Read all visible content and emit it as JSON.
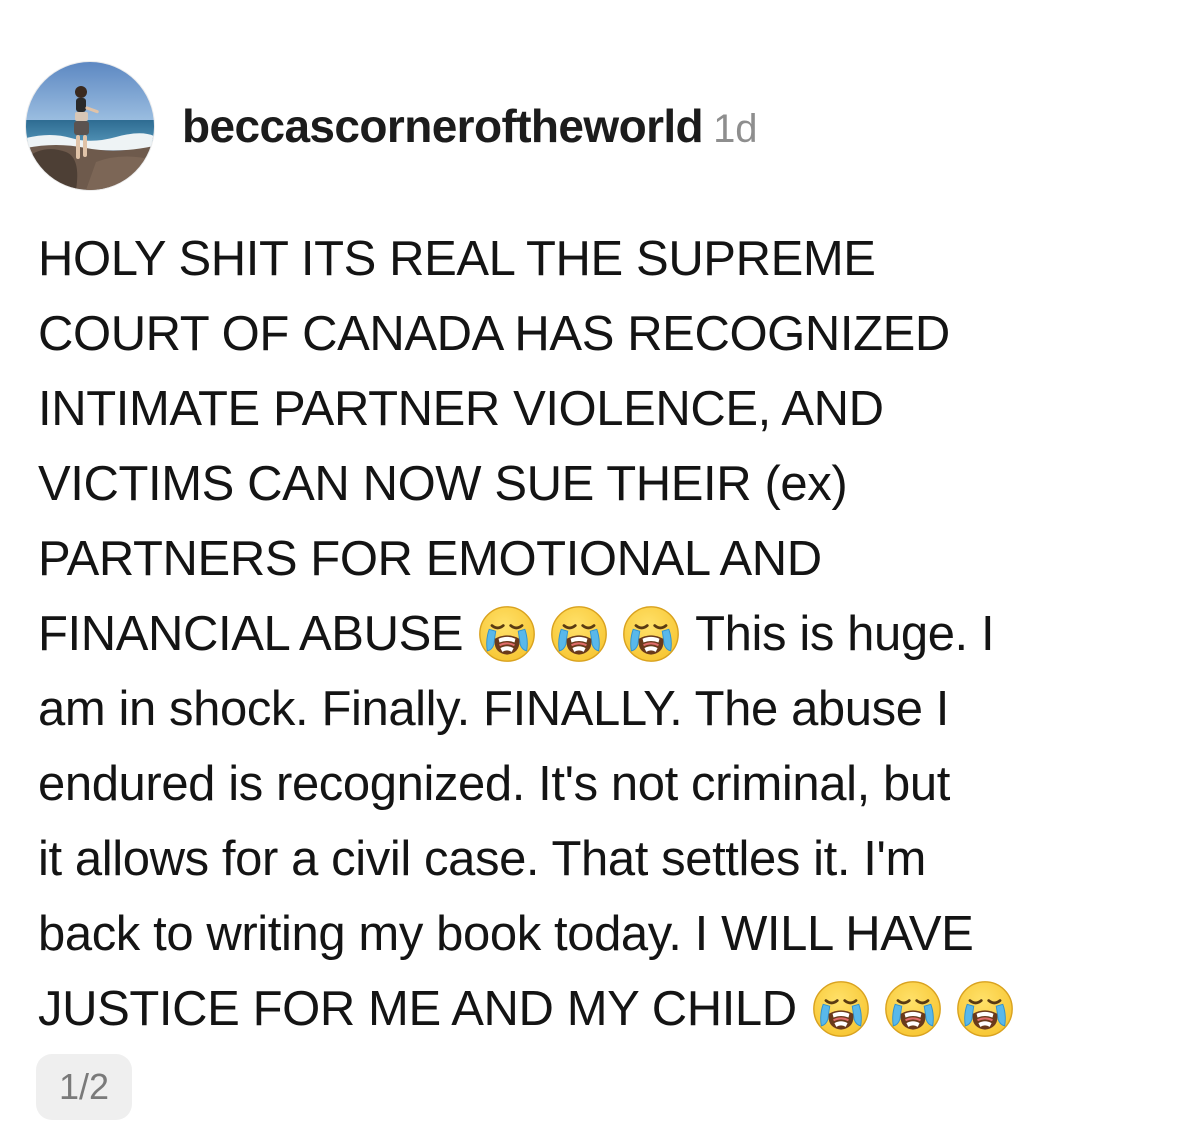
{
  "post": {
    "avatar": "profile-photo",
    "username": "beccascorneroftheworld",
    "time": "1d"
  },
  "caption": {
    "lines": [
      {
        "text": "HOLY SHIT ITS REAL THE SUPREME"
      },
      {
        "text": "COURT OF CANADA HAS RECOGNIZED"
      },
      {
        "text": "INTIMATE PARTNER VIOLENCE, AND"
      },
      {
        "text": "VICTIMS CAN NOW SUE THEIR (ex)"
      },
      {
        "text": "PARTNERS FOR EMOTIONAL AND"
      },
      {
        "before": "FINANCIAL ABUSE",
        "emoji": [
          "😭",
          "😭",
          "😭"
        ],
        "after": "This is huge. I"
      },
      {
        "text": "am in shock. Finally. FINALLY. The abuse I"
      },
      {
        "text": "endured is recognized. It's not criminal, but"
      },
      {
        "text": "it allows for a civil case. That settles it. I'm"
      },
      {
        "text": "back to writing my book today. I WILL HAVE"
      },
      {
        "before": "JUSTICE FOR ME AND MY CHILD",
        "emoji": [
          "😭",
          "😭",
          "😭"
        ]
      }
    ]
  },
  "pager": {
    "label": "1/2"
  },
  "icons": {
    "emoji_name": "loudly-crying-face-icon"
  },
  "colors": {
    "username": "#1c1c1c",
    "timestamp": "#8e8e8e",
    "text": "#141414",
    "pager_bg": "#efefef",
    "emoji_face": "#f7c531"
  }
}
